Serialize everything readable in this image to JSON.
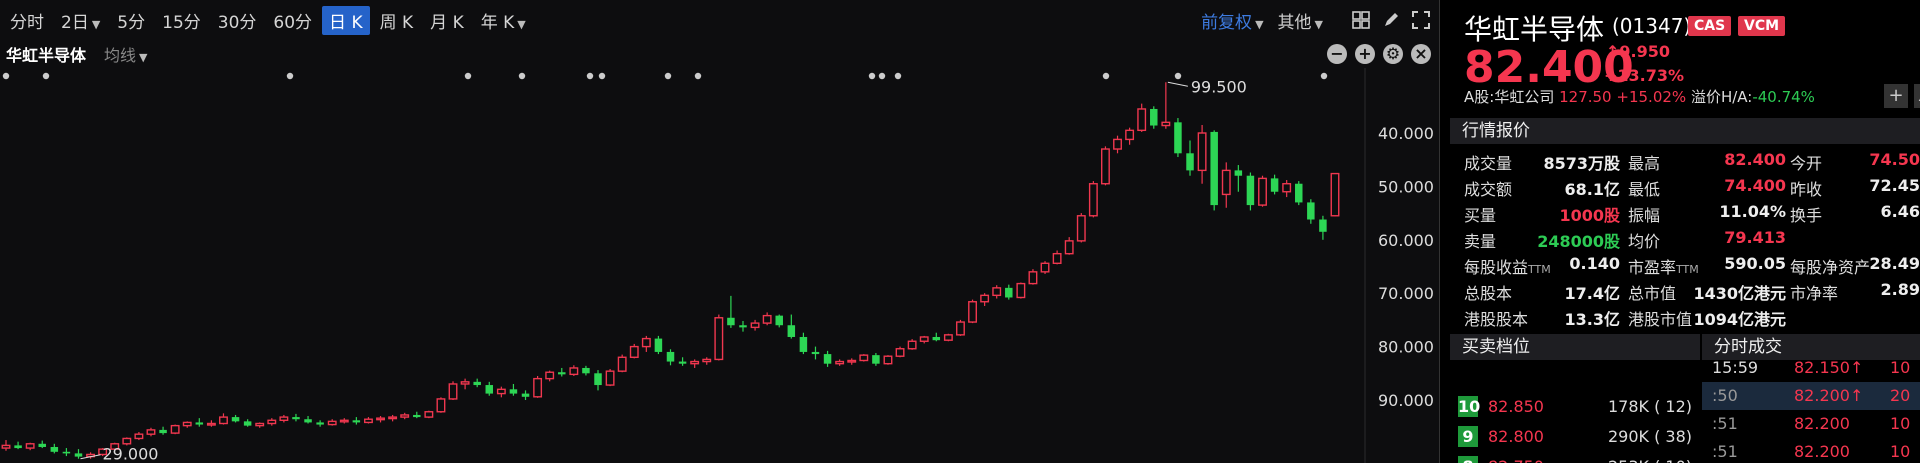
{
  "toolbar": {
    "periods": [
      {
        "label": "分时",
        "caret": false,
        "active": false
      },
      {
        "label": "2日",
        "caret": true,
        "active": false
      },
      {
        "label": "5分",
        "caret": false,
        "active": false
      },
      {
        "label": "15分",
        "caret": false,
        "active": false
      },
      {
        "label": "30分",
        "caret": false,
        "active": false
      },
      {
        "label": "60分",
        "caret": false,
        "active": false
      },
      {
        "label": "日 K",
        "caret": false,
        "active": true
      },
      {
        "label": "周 K",
        "caret": false,
        "active": false
      },
      {
        "label": "月 K",
        "caret": false,
        "active": false
      },
      {
        "label": "年 K",
        "caret": true,
        "active": false
      }
    ],
    "adjust": "前复权",
    "other": "其他"
  },
  "chart": {
    "stock_name": "华虹半导体",
    "ma_label": "均线",
    "y_ticks": [
      "90.000",
      "80.000",
      "70.000",
      "60.000",
      "50.000",
      "40.000"
    ],
    "high_label": "99.500",
    "low_label": "29.000"
  },
  "chart_data": {
    "type": "candlestick",
    "yticks": [
      40,
      50,
      60,
      70,
      80,
      90
    ],
    "high": 99.5,
    "low": 29.0,
    "candles": [
      [
        31,
        32.5,
        30.5,
        31.5
      ],
      [
        31.5,
        32.2,
        30.8,
        31
      ],
      [
        31,
        32,
        30.6,
        31.8
      ],
      [
        31.8,
        32.4,
        31,
        31.2
      ],
      [
        31.2,
        31.8,
        30,
        30.3
      ],
      [
        30.3,
        31,
        29.5,
        30
      ],
      [
        30,
        30.8,
        29,
        29.4
      ],
      [
        29.4,
        30.2,
        29,
        29.8
      ],
      [
        29.8,
        31,
        29.5,
        30.8
      ],
      [
        30.8,
        32,
        30.5,
        31.8
      ],
      [
        31.8,
        33,
        31.5,
        32.8
      ],
      [
        32.8,
        34,
        32.5,
        33.6
      ],
      [
        33.6,
        34.8,
        33.2,
        34.4
      ],
      [
        34.4,
        35,
        33.5,
        33.8
      ],
      [
        33.8,
        35.4,
        33.6,
        35.2
      ],
      [
        35.2,
        36,
        34.8,
        35.8
      ],
      [
        35.8,
        36.6,
        35,
        35.4
      ],
      [
        35.4,
        36.2,
        35,
        35.6
      ],
      [
        35.6,
        37.5,
        35.4,
        36.8
      ],
      [
        36.8,
        37.2,
        35.8,
        36
      ],
      [
        36,
        36.4,
        35,
        35.2
      ],
      [
        35.2,
        35.8,
        34.8,
        35.6
      ],
      [
        35.6,
        36.6,
        35.2,
        36.2
      ],
      [
        36.2,
        37.2,
        35.8,
        36.8
      ],
      [
        36.8,
        37.4,
        36,
        36.4
      ],
      [
        36.4,
        37,
        35.6,
        35.8
      ],
      [
        35.8,
        36.2,
        35,
        35.4
      ],
      [
        35.4,
        36.4,
        35.2,
        36
      ],
      [
        36,
        36.6,
        35.6,
        36.2
      ],
      [
        36.2,
        36.8,
        35.4,
        35.8
      ],
      [
        35.8,
        36.8,
        35.6,
        36.4
      ],
      [
        36.4,
        37,
        35.8,
        36.6
      ],
      [
        36.6,
        37.2,
        36,
        36.8
      ],
      [
        36.8,
        37.6,
        36.4,
        37.2
      ],
      [
        37.2,
        37.8,
        36.6,
        36.8
      ],
      [
        36.8,
        38,
        36.6,
        37.8
      ],
      [
        37.8,
        40.5,
        37.6,
        40.2
      ],
      [
        40.2,
        43.5,
        40,
        43
      ],
      [
        43,
        44,
        42,
        43.4
      ],
      [
        43.4,
        44,
        42.4,
        42.8
      ],
      [
        42.8,
        43.4,
        40.8,
        41.2
      ],
      [
        41.2,
        42.5,
        40.5,
        42
      ],
      [
        42,
        43,
        40.8,
        41.2
      ],
      [
        41.2,
        41.8,
        40,
        40.6
      ],
      [
        40.6,
        44.5,
        40.4,
        44
      ],
      [
        44,
        45.5,
        43.5,
        45.2
      ],
      [
        45.2,
        46,
        44.4,
        44.8
      ],
      [
        44.8,
        46.5,
        44.5,
        46
      ],
      [
        46,
        46.4,
        44.6,
        45
      ],
      [
        45,
        45.6,
        41.8,
        42.8
      ],
      [
        42.8,
        45.8,
        42.6,
        45.4
      ],
      [
        45.4,
        48.5,
        45.2,
        48
      ],
      [
        48,
        50.5,
        47.8,
        50
      ],
      [
        50,
        52,
        49,
        51.5
      ],
      [
        51.5,
        52,
        48.6,
        49
      ],
      [
        49,
        49.5,
        46.5,
        47.2
      ],
      [
        47.2,
        48,
        46.4,
        46.8
      ],
      [
        46.8,
        47.6,
        46,
        47.2
      ],
      [
        47.2,
        48,
        46.6,
        47.6
      ],
      [
        47.6,
        56,
        47.4,
        55.4
      ],
      [
        55.4,
        59.5,
        53.5,
        54
      ],
      [
        54,
        54.8,
        52.8,
        53.6
      ],
      [
        53.6,
        55,
        53,
        54.4
      ],
      [
        54.4,
        56.4,
        54,
        55.8
      ],
      [
        55.8,
        56,
        53.6,
        54
      ],
      [
        54,
        56,
        51.5,
        51.8
      ],
      [
        51.8,
        52.6,
        48.6,
        49
      ],
      [
        49,
        50,
        47.6,
        48.6
      ],
      [
        48.6,
        49.2,
        46.2,
        46.8
      ],
      [
        46.8,
        47.6,
        46.4,
        47.2
      ],
      [
        47.2,
        47.8,
        46.6,
        47.4
      ],
      [
        47.4,
        48.6,
        47.2,
        48.4
      ],
      [
        48.4,
        48.8,
        46.4,
        46.8
      ],
      [
        46.8,
        48.4,
        46.6,
        48.2
      ],
      [
        48.2,
        50,
        48,
        49.6
      ],
      [
        49.6,
        51.4,
        49.4,
        51
      ],
      [
        51,
        52,
        50.6,
        51.8
      ],
      [
        51.8,
        52.6,
        51,
        51.2
      ],
      [
        51.2,
        52.4,
        51,
        52.2
      ],
      [
        52.2,
        55,
        52,
        54.6
      ],
      [
        54.6,
        58.8,
        54.4,
        58.4
      ],
      [
        58.4,
        60,
        57.6,
        59.6
      ],
      [
        59.6,
        61.5,
        59,
        61
      ],
      [
        61,
        61.6,
        58.8,
        59.2
      ],
      [
        59.2,
        62,
        59,
        61.8
      ],
      [
        61.8,
        64.5,
        61.6,
        64
      ],
      [
        64,
        66,
        63.6,
        65.6
      ],
      [
        65.6,
        68,
        65.4,
        67.4
      ],
      [
        67.4,
        70.5,
        67.2,
        69.8
      ],
      [
        69.8,
        75,
        69.5,
        74.5
      ],
      [
        74.5,
        81,
        74.2,
        80.5
      ],
      [
        80.5,
        87.5,
        80.2,
        87
      ],
      [
        87,
        89.5,
        86.2,
        88.8
      ],
      [
        88.8,
        91,
        87.8,
        90.5
      ],
      [
        90.5,
        95.5,
        90.2,
        94.5
      ],
      [
        94.5,
        95,
        90.8,
        91.4
      ],
      [
        91.4,
        99.5,
        90.8,
        92
      ],
      [
        92,
        92.8,
        85.5,
        86.2
      ],
      [
        86.2,
        88.6,
        82,
        83
      ],
      [
        83,
        91.5,
        80.5,
        90
      ],
      [
        90.2,
        90.5,
        75.5,
        76.5
      ],
      [
        78.5,
        84.5,
        76,
        83
      ],
      [
        83,
        84,
        79,
        82
      ],
      [
        82,
        82.6,
        75.5,
        76.5
      ],
      [
        76.5,
        82,
        76.2,
        81.5
      ],
      [
        81.5,
        82.2,
        78.5,
        79
      ],
      [
        79,
        81.2,
        78,
        80.5
      ],
      [
        80.5,
        81,
        76.5,
        77
      ],
      [
        77,
        77.6,
        73,
        73.8
      ],
      [
        73.8,
        74.5,
        70,
        71.5
      ],
      [
        74.5,
        82.4,
        74.4,
        82.4
      ]
    ]
  },
  "quote": {
    "name": "华虹半导体",
    "code": "(01347)",
    "tag1": "CAS",
    "tag2": "VCM",
    "price": "82.400",
    "change": "9.950",
    "pct": "+13.73%",
    "a_label": "A股:华虹公司",
    "a_price": "127.50",
    "a_pct": "+15.02%",
    "premium_label": "溢价H/A:",
    "premium_val": "-40.74%"
  },
  "sections": {
    "quote": "行情报价",
    "bidask": "买卖档位",
    "ticks": "分时成交"
  },
  "stats": [
    [
      {
        "l": "成交量",
        "v": "8573万股",
        "c": "white"
      },
      {
        "l": "最高",
        "v": "82.400",
        "c": "red"
      },
      {
        "l": "今开",
        "v": "74.50",
        "c": "red"
      }
    ],
    [
      {
        "l": "成交额",
        "v": "68.1亿",
        "c": "white"
      },
      {
        "l": "最低",
        "v": "74.400",
        "c": "red"
      },
      {
        "l": "昨收",
        "v": "72.45",
        "c": "white"
      }
    ],
    [
      {
        "l": "买量",
        "v": "1000股",
        "c": "red"
      },
      {
        "l": "振幅",
        "v": "11.04%",
        "c": "white"
      },
      {
        "l": "换手",
        "v": "6.46",
        "c": "white"
      }
    ],
    [
      {
        "l": "卖量",
        "v": "248000股",
        "c": "green"
      },
      {
        "l": "均价",
        "v": "79.413",
        "c": "red"
      }
    ],
    [
      {
        "l": "每股收益",
        "ttm": "TTM",
        "v": "0.140",
        "c": "white"
      },
      {
        "l": "市盈率",
        "ttm": "TTM",
        "v": "590.05",
        "c": "white"
      },
      {
        "l": "每股净资产",
        "v": "28.49",
        "c": "white"
      }
    ],
    [
      {
        "l": "总股本",
        "v": "17.4亿",
        "c": "white"
      },
      {
        "l": "总市值",
        "v": "1430亿港元",
        "c": "white"
      },
      {
        "l": "市净率",
        "v": "2.89",
        "c": "white"
      }
    ],
    [
      {
        "l": "港股股本",
        "v": "13.3亿",
        "c": "white"
      },
      {
        "l": "港股市值",
        "v": "1094亿港元",
        "c": "white"
      }
    ]
  ],
  "bids": [
    {
      "level": "10",
      "price": "82.850",
      "vol": "178K (  12)"
    },
    {
      "level": "9",
      "price": "82.800",
      "vol": "290K (  38)"
    },
    {
      "level": "8",
      "price": "82.750",
      "vol": "253K (  10)"
    }
  ],
  "ticks": [
    {
      "time": "15:59",
      "price": "82.150↑",
      "vol": "10"
    },
    {
      "time": ":50",
      "price": "82.200↑",
      "vol": "20"
    },
    {
      "time": ":51",
      "price": "82.200",
      "vol": "10"
    },
    {
      "time": ":51",
      "price": "82.200",
      "vol": "10"
    }
  ]
}
